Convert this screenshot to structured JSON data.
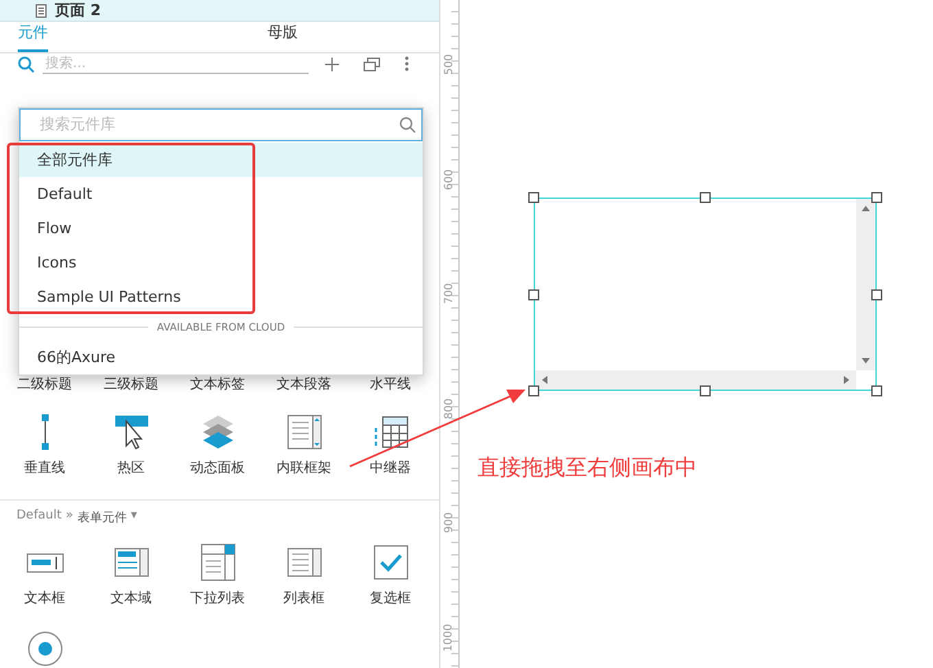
{
  "page_row": {
    "title": "页面 2"
  },
  "tabs": [
    {
      "label": "元件",
      "selected": true
    },
    {
      "label": "母版",
      "selected": false
    }
  ],
  "search": {
    "placeholder": "搜索..."
  },
  "covered_row_labels": [
    "二级标题",
    "三级标题",
    "文本标签",
    "文本段落",
    "水平线"
  ],
  "common_widgets": [
    {
      "kind": "vline",
      "label": "垂直线"
    },
    {
      "kind": "hotspot",
      "label": "热区"
    },
    {
      "kind": "panel",
      "label": "动态面板"
    },
    {
      "kind": "frame",
      "label": "内联框架"
    },
    {
      "kind": "repeater",
      "label": "中继器"
    }
  ],
  "section": {
    "library": "Default",
    "separator": "»",
    "name": "表单元件",
    "caret": "▾"
  },
  "form_widgets": [
    {
      "kind": "textbox",
      "label": "文本框"
    },
    {
      "kind": "textarea",
      "label": "文本域"
    },
    {
      "kind": "droplist",
      "label": "下拉列表"
    },
    {
      "kind": "listbox",
      "label": "列表框"
    },
    {
      "kind": "checkbox",
      "label": "复选框"
    }
  ],
  "last_widgets": [
    {
      "kind": "radio"
    }
  ],
  "library_dropdown": {
    "placeholder": "搜索元件库",
    "items": [
      {
        "label": "全部元件库",
        "selected": true
      },
      {
        "label": "Default",
        "selected": false
      },
      {
        "label": "Flow",
        "selected": false
      },
      {
        "label": "Icons",
        "selected": false
      },
      {
        "label": "Sample UI Patterns",
        "selected": false
      }
    ],
    "cloud_header": "AVAILABLE FROM CLOUD",
    "cloud_items": [
      "66的Axure"
    ]
  },
  "ruler_labels": [
    "500",
    "600",
    "700",
    "800",
    "900",
    "1000"
  ],
  "canvas_widget": {
    "kind": "frame",
    "selected": true
  },
  "annotation": {
    "text": "直接拖拽至右侧画布中"
  }
}
